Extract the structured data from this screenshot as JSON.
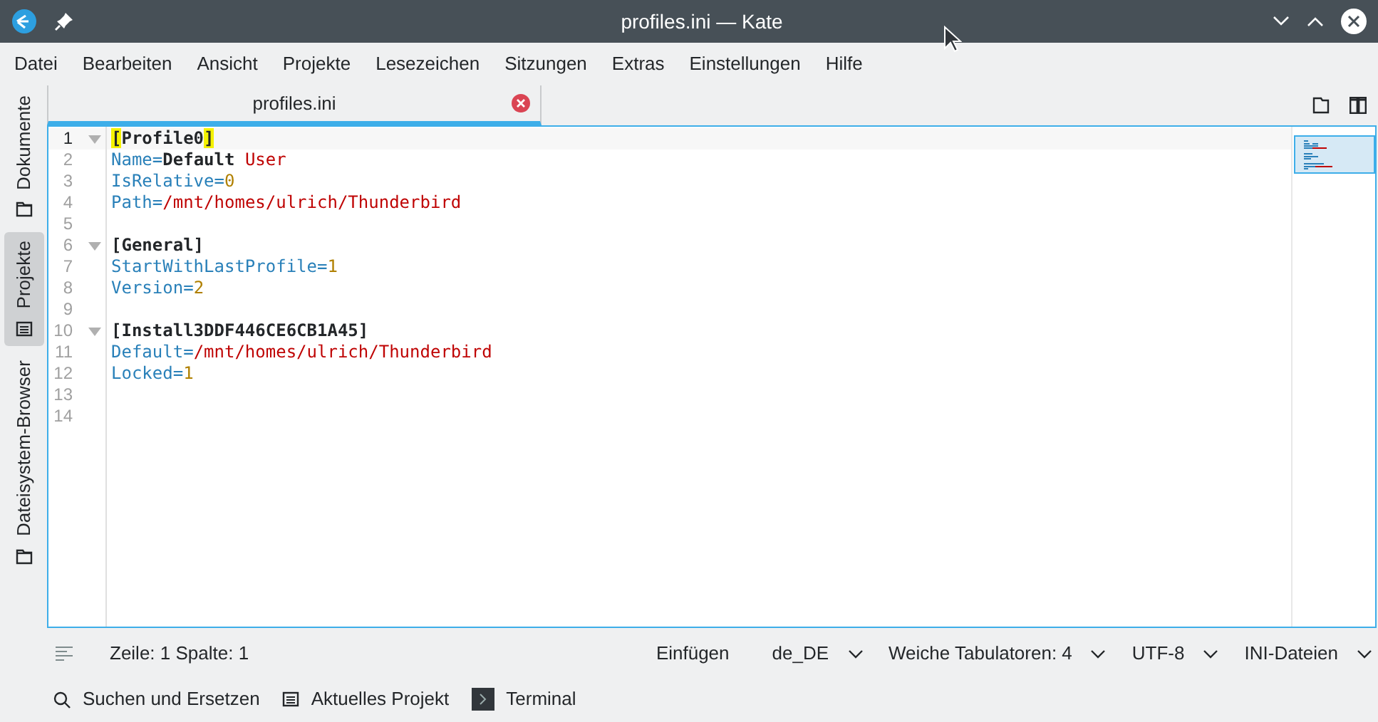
{
  "window": {
    "title": "profiles.ini — Kate"
  },
  "menu": [
    "Datei",
    "Bearbeiten",
    "Ansicht",
    "Projekte",
    "Lesezeichen",
    "Sitzungen",
    "Extras",
    "Einstellungen",
    "Hilfe"
  ],
  "side_tabs": [
    {
      "label": "Dokumente",
      "selected": false
    },
    {
      "label": "Projekte",
      "selected": true
    },
    {
      "label": "Dateisystem-Browser",
      "selected": false
    }
  ],
  "doc_tabs": [
    {
      "label": "profiles.ini",
      "selected": true
    }
  ],
  "editor": {
    "lines": [
      {
        "number": "1",
        "foldable": true,
        "current": true,
        "tokens": [
          {
            "t": "[",
            "kind": "bracket_match"
          },
          {
            "t": "Profile0",
            "kind": "section"
          },
          {
            "t": "]",
            "kind": "bracket_match"
          }
        ]
      },
      {
        "number": "2",
        "foldable": false,
        "current": false,
        "tokens": [
          {
            "t": "Name",
            "kind": "key"
          },
          {
            "t": "=",
            "kind": "key"
          },
          {
            "t": "Default",
            "kind": "bold"
          },
          {
            "t": " User",
            "kind": "string"
          }
        ]
      },
      {
        "number": "3",
        "foldable": false,
        "current": false,
        "tokens": [
          {
            "t": "IsRelative",
            "kind": "key"
          },
          {
            "t": "=",
            "kind": "key"
          },
          {
            "t": "0",
            "kind": "number"
          }
        ]
      },
      {
        "number": "4",
        "foldable": false,
        "current": false,
        "tokens": [
          {
            "t": "Path",
            "kind": "key"
          },
          {
            "t": "=",
            "kind": "key"
          },
          {
            "t": "/mnt/homes/ulrich/Thunderbird",
            "kind": "string"
          }
        ]
      },
      {
        "number": "5",
        "foldable": false,
        "current": false
      },
      {
        "number": "6",
        "foldable": true,
        "current": false,
        "tokens": [
          {
            "t": "[General]",
            "kind": "section"
          }
        ]
      },
      {
        "number": "7",
        "foldable": false,
        "current": false,
        "tokens": [
          {
            "t": "StartWithLastProfile",
            "kind": "key"
          },
          {
            "t": "=",
            "kind": "key"
          },
          {
            "t": "1",
            "kind": "number"
          }
        ]
      },
      {
        "number": "8",
        "foldable": false,
        "current": false,
        "tokens": [
          {
            "t": "Version",
            "kind": "key"
          },
          {
            "t": "=",
            "kind": "key"
          },
          {
            "t": "2",
            "kind": "number"
          }
        ]
      },
      {
        "number": "9",
        "foldable": false,
        "current": false
      },
      {
        "number": "10",
        "foldable": true,
        "current": false,
        "tokens": [
          {
            "t": "[Install3DDF446CE6CB1A45]",
            "kind": "section"
          }
        ]
      },
      {
        "number": "11",
        "foldable": false,
        "current": false,
        "tokens": [
          {
            "t": "Default",
            "kind": "key"
          },
          {
            "t": "=",
            "kind": "key"
          },
          {
            "t": "/mnt/homes/ulrich/Thunderbird",
            "kind": "string"
          }
        ]
      },
      {
        "number": "12",
        "foldable": false,
        "current": false,
        "tokens": [
          {
            "t": "Locked",
            "kind": "key"
          },
          {
            "t": "=",
            "kind": "key"
          },
          {
            "t": "1",
            "kind": "number"
          }
        ]
      },
      {
        "number": "13",
        "foldable": false,
        "current": false
      },
      {
        "number": "14",
        "foldable": false,
        "current": false
      }
    ]
  },
  "status_bar": {
    "position": "Zeile: 1 Spalte: 1",
    "mode": "Einfügen",
    "dropdowns": [
      "de_DE",
      "Weiche Tabulatoren: 4",
      "UTF-8",
      "INI-Dateien"
    ]
  },
  "tool_views": [
    "Suchen und Ersetzen",
    "Aktuelles Projekt",
    "Terminal"
  ]
}
